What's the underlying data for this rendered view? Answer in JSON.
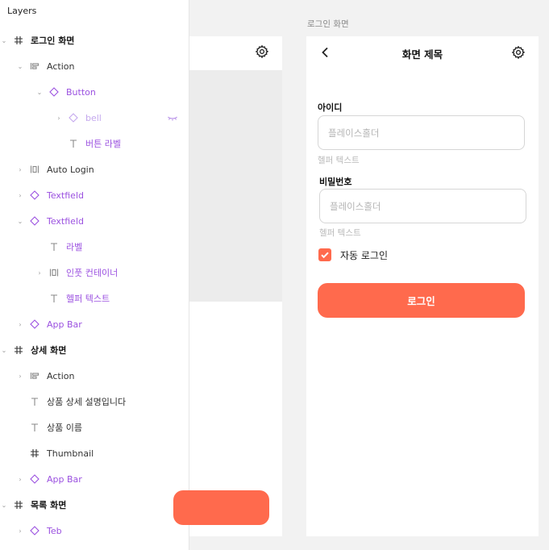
{
  "layers_panel": {
    "title": "Layers",
    "items": [
      {
        "label": "로그인 화면",
        "icon": "frame-hash-icon",
        "kind": "frame",
        "expanded": true
      },
      {
        "label": "Action",
        "icon": "horizontal-stack-icon",
        "kind": "normal",
        "expanded": true
      },
      {
        "label": "Button",
        "icon": "component-diamond-icon",
        "kind": "comp",
        "expanded": true
      },
      {
        "label": "bell",
        "icon": "component-diamond-icon",
        "kind": "dim",
        "expanded": false,
        "hidden": true
      },
      {
        "label": "버튼 라벨",
        "icon": "text-t-icon",
        "kind": "comp"
      },
      {
        "label": "Auto Login",
        "icon": "auto-layout-icon",
        "kind": "normal",
        "expanded": false
      },
      {
        "label": "Textfield",
        "icon": "component-diamond-icon",
        "kind": "comp",
        "expanded": false
      },
      {
        "label": "Textfield",
        "icon": "component-diamond-icon",
        "kind": "comp",
        "expanded": true
      },
      {
        "label": "라벨",
        "icon": "text-t-icon",
        "kind": "comp"
      },
      {
        "label": "인풋 컨테이너",
        "icon": "auto-layout-icon",
        "kind": "comp",
        "expanded": false
      },
      {
        "label": "헬퍼 텍스트",
        "icon": "text-t-icon",
        "kind": "comp"
      },
      {
        "label": "App Bar",
        "icon": "component-diamond-icon",
        "kind": "comp",
        "expanded": false
      },
      {
        "label": "상세 화면",
        "icon": "frame-hash-icon",
        "kind": "frame",
        "expanded": true
      },
      {
        "label": "Action",
        "icon": "horizontal-stack-icon",
        "kind": "normal",
        "expanded": false
      },
      {
        "label": "상품 상세 설명입니다",
        "icon": "text-t-icon",
        "kind": "normal"
      },
      {
        "label": "상품 이름",
        "icon": "text-t-icon",
        "kind": "normal"
      },
      {
        "label": "Thumbnail",
        "icon": "frame-hash-icon",
        "kind": "normal"
      },
      {
        "label": "App Bar",
        "icon": "component-diamond-icon",
        "kind": "comp",
        "expanded": false
      },
      {
        "label": "목록 화면",
        "icon": "frame-hash-icon",
        "kind": "frame",
        "expanded": true
      },
      {
        "label": "Teb",
        "icon": "component-diamond-icon",
        "kind": "comp",
        "expanded": false
      }
    ]
  },
  "canvas": {
    "frame_label": "로그인 화면",
    "app_bar": {
      "title": "화면 제목"
    },
    "id_field": {
      "label": "아이디",
      "placeholder": "플레이스홀더",
      "helper": "헬퍼 텍스트"
    },
    "pw_field": {
      "label": "비밀번호",
      "placeholder": "플레이스홀더",
      "helper": "헬퍼 텍스트"
    },
    "auto_login": {
      "label": "자동 로그인",
      "checked": true
    },
    "login_button": {
      "label": "로그인"
    }
  },
  "colors": {
    "accent": "#ff6a4d",
    "component": "#9b51e0",
    "canvas_bg": "#f2f2f2"
  }
}
